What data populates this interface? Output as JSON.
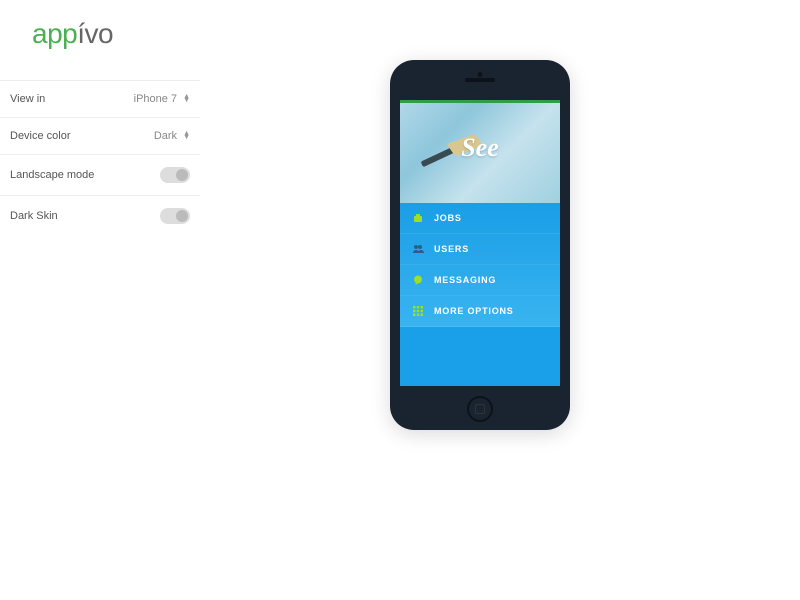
{
  "logo": {
    "green": "app",
    "dark": "ívo"
  },
  "settings": {
    "view_in": {
      "label": "View in",
      "value": "iPhone 7"
    },
    "device_color": {
      "label": "Device color",
      "value": "Dark"
    },
    "landscape": {
      "label": "Landscape mode",
      "enabled": false
    },
    "dark_skin": {
      "label": "Dark Skin",
      "enabled": false
    }
  },
  "app": {
    "hero_title": "See",
    "menu": [
      {
        "icon": "briefcase-icon",
        "label": "JOBS"
      },
      {
        "icon": "users-icon",
        "label": "USERS"
      },
      {
        "icon": "message-bubble-icon",
        "label": "MESSAGING"
      },
      {
        "icon": "grid-icon",
        "label": "MORE OPTIONS"
      }
    ]
  }
}
